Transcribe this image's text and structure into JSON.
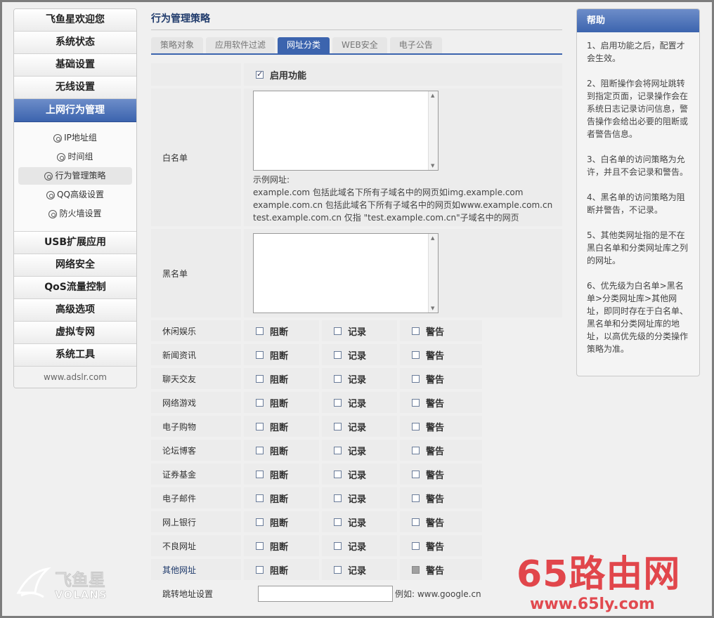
{
  "sidebar": {
    "items_top": [
      "飞鱼星欢迎您",
      "系统状态",
      "基础设置",
      "无线设置"
    ],
    "active": "上网行为管理",
    "sub_items": [
      "IP地址组",
      "时间组",
      "行为管理策略",
      "QQ高级设置",
      "防火墙设置"
    ],
    "items_bottom": [
      "USB扩展应用",
      "网络安全",
      "QoS流量控制",
      "高级选项",
      "虚拟专网",
      "系统工具"
    ],
    "footer": "www.adslr.com"
  },
  "logo": {
    "text": "飞鱼星",
    "sub": "VOLANS"
  },
  "main": {
    "title": "行为管理策略",
    "tabs": [
      "策略对象",
      "应用软件过滤",
      "网址分类",
      "WEB安全",
      "电子公告"
    ],
    "enable_label": "启用功能",
    "whitelist_label": "白名单",
    "example_lines": [
      "示例网址:",
      "example.com 包括此域名下所有子域名中的网页如img.example.com",
      "example.com.cn 包括此域名下所有子域名中的网页如www.example.com.cn",
      "test.example.com.cn 仅指 \"test.example.com.cn\"子域名中的网页"
    ],
    "blacklist_label": "黑名单",
    "actions": [
      "阻断",
      "记录",
      "警告"
    ],
    "categories": [
      "休闲娱乐",
      "新闻资讯",
      "聊天交友",
      "网络游戏",
      "电子购物",
      "论坛博客",
      "证券基金",
      "电子邮件",
      "网上银行",
      "不良网址",
      "其他网址"
    ],
    "redirect_label": "跳转地址设置",
    "redirect_hint": "例如: www.google.cn"
  },
  "help": {
    "title": "帮助",
    "items": [
      "1、启用功能之后，配置才会生效。",
      "2、阻断操作会将网址跳转到指定页面，记录操作会在系统日志记录访问信息，警告操作会给出必要的阻断或者警告信息。",
      "3、白名单的访问策略为允许，并且不会记录和警告。",
      "4、黑名单的访问策略为阻断并警告，不记录。",
      "5、其他类网址指的是不在黑白名单和分类网址库之列的网址。",
      "6、优先级为白名单>黑名单>分类网址库>其他网址，即同时存在于白名单、黑名单和分类网址库的地址，以高优先级的分类操作策略为准。"
    ]
  },
  "watermark": {
    "big": "65路由网",
    "url": "www.65ly.com"
  },
  "colors": {
    "accent": "#3c64ae",
    "watermark": "#e0383e"
  }
}
